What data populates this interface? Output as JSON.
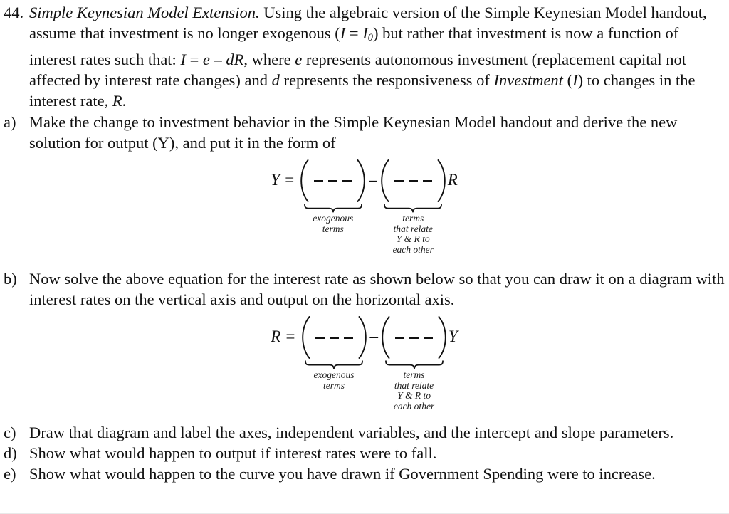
{
  "document": {
    "question_number": "44.",
    "title": "Simple Keynesian Model Extension.",
    "intro_part1": " Using the algebraic version of the Simple Keynesian Model handout, assume that investment is no longer exogenous (",
    "intro_I": "I",
    "intro_eq1": " = ",
    "intro_I0_base": "I",
    "intro_I0_sub": "0",
    "intro_part2": ") but rather that investment is now a function of interest rates such that: ",
    "eq_inline_I": "I",
    "eq_inline_eq": " = ",
    "eq_inline_e": "e",
    "eq_inline_minus": " – ",
    "eq_inline_dR": "dR",
    "intro_part3": ", where ",
    "intro_e": "e",
    "intro_part4": " represents autonomous investment (replacement capital not affected by interest rate changes) and ",
    "intro_d": "d",
    "intro_part5": " represents the responsiveness of ",
    "intro_investment": "Investment",
    "intro_part6": " (",
    "intro_I_paren": "I",
    "intro_part7": ") to changes in the interest rate, ",
    "intro_R": "R",
    "intro_part8": "."
  },
  "items": [
    {
      "marker": "a)",
      "text": "Make the change to investment behavior in the Simple Keynesian Model handout and derive the new solution for output (Y), and put it in the form of"
    },
    {
      "marker": "b)",
      "text": "Now solve the above equation for the interest rate as shown below so that you can draw it on a diagram with interest rates on the vertical axis and output on the horizontal axis."
    },
    {
      "marker": "c)",
      "text": "Draw that diagram and label the axes, independent variables, and the intercept and slope parameters."
    },
    {
      "marker": "d)",
      "text": "Show what would happen to output if interest rates were to fall."
    },
    {
      "marker": "e)",
      "text": "Show what would happen to the curve you have drawn if Government Spending were to increase."
    }
  ],
  "equations": [
    {
      "lhs": "Y =",
      "operator": "–",
      "trailing_variable": "R",
      "dashes_count": 3,
      "groups": [
        {
          "caption": "exogenous\nterms"
        },
        {
          "caption": "terms\nthat relate\nY & R to\neach other"
        }
      ]
    },
    {
      "lhs": "R =",
      "operator": "–",
      "trailing_variable": "Y",
      "dashes_count": 3,
      "groups": [
        {
          "caption": "exogenous\nterms"
        },
        {
          "caption": "terms\nthat relate\nY & R to\neach other"
        }
      ]
    }
  ],
  "colors": {
    "text": "#111111",
    "background": "#ffffff",
    "bottom_rule": "#e9e9e9"
  }
}
